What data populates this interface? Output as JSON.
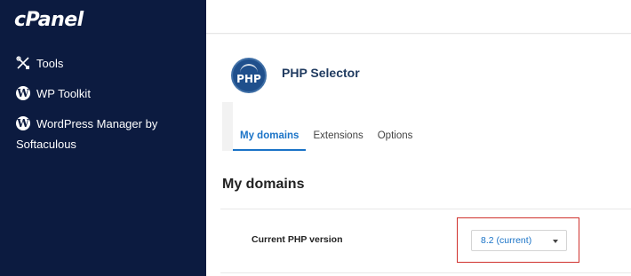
{
  "sidebar": {
    "logo": "cPanel",
    "items": [
      {
        "label": "Tools",
        "icon": "tools-icon"
      },
      {
        "label": "WP Toolkit",
        "icon": "wordpress-icon"
      },
      {
        "label": "WordPress Manager by Softaculous",
        "label_line1": "WordPress Manager by",
        "label_line2": "Softaculous",
        "icon": "wordpress-icon"
      }
    ]
  },
  "header": {
    "logo_text": "PHP",
    "title": "PHP Selector"
  },
  "tabs": [
    {
      "label": "My domains",
      "active": true
    },
    {
      "label": "Extensions",
      "active": false
    },
    {
      "label": "Options",
      "active": false
    }
  ],
  "main": {
    "section_title": "My domains",
    "row_label": "Current PHP version",
    "php_version_select": "8.2 (current)"
  },
  "colors": {
    "sidebar_bg": "#0c1b40",
    "accent": "#1a73c7",
    "highlight": "#d0312d"
  }
}
